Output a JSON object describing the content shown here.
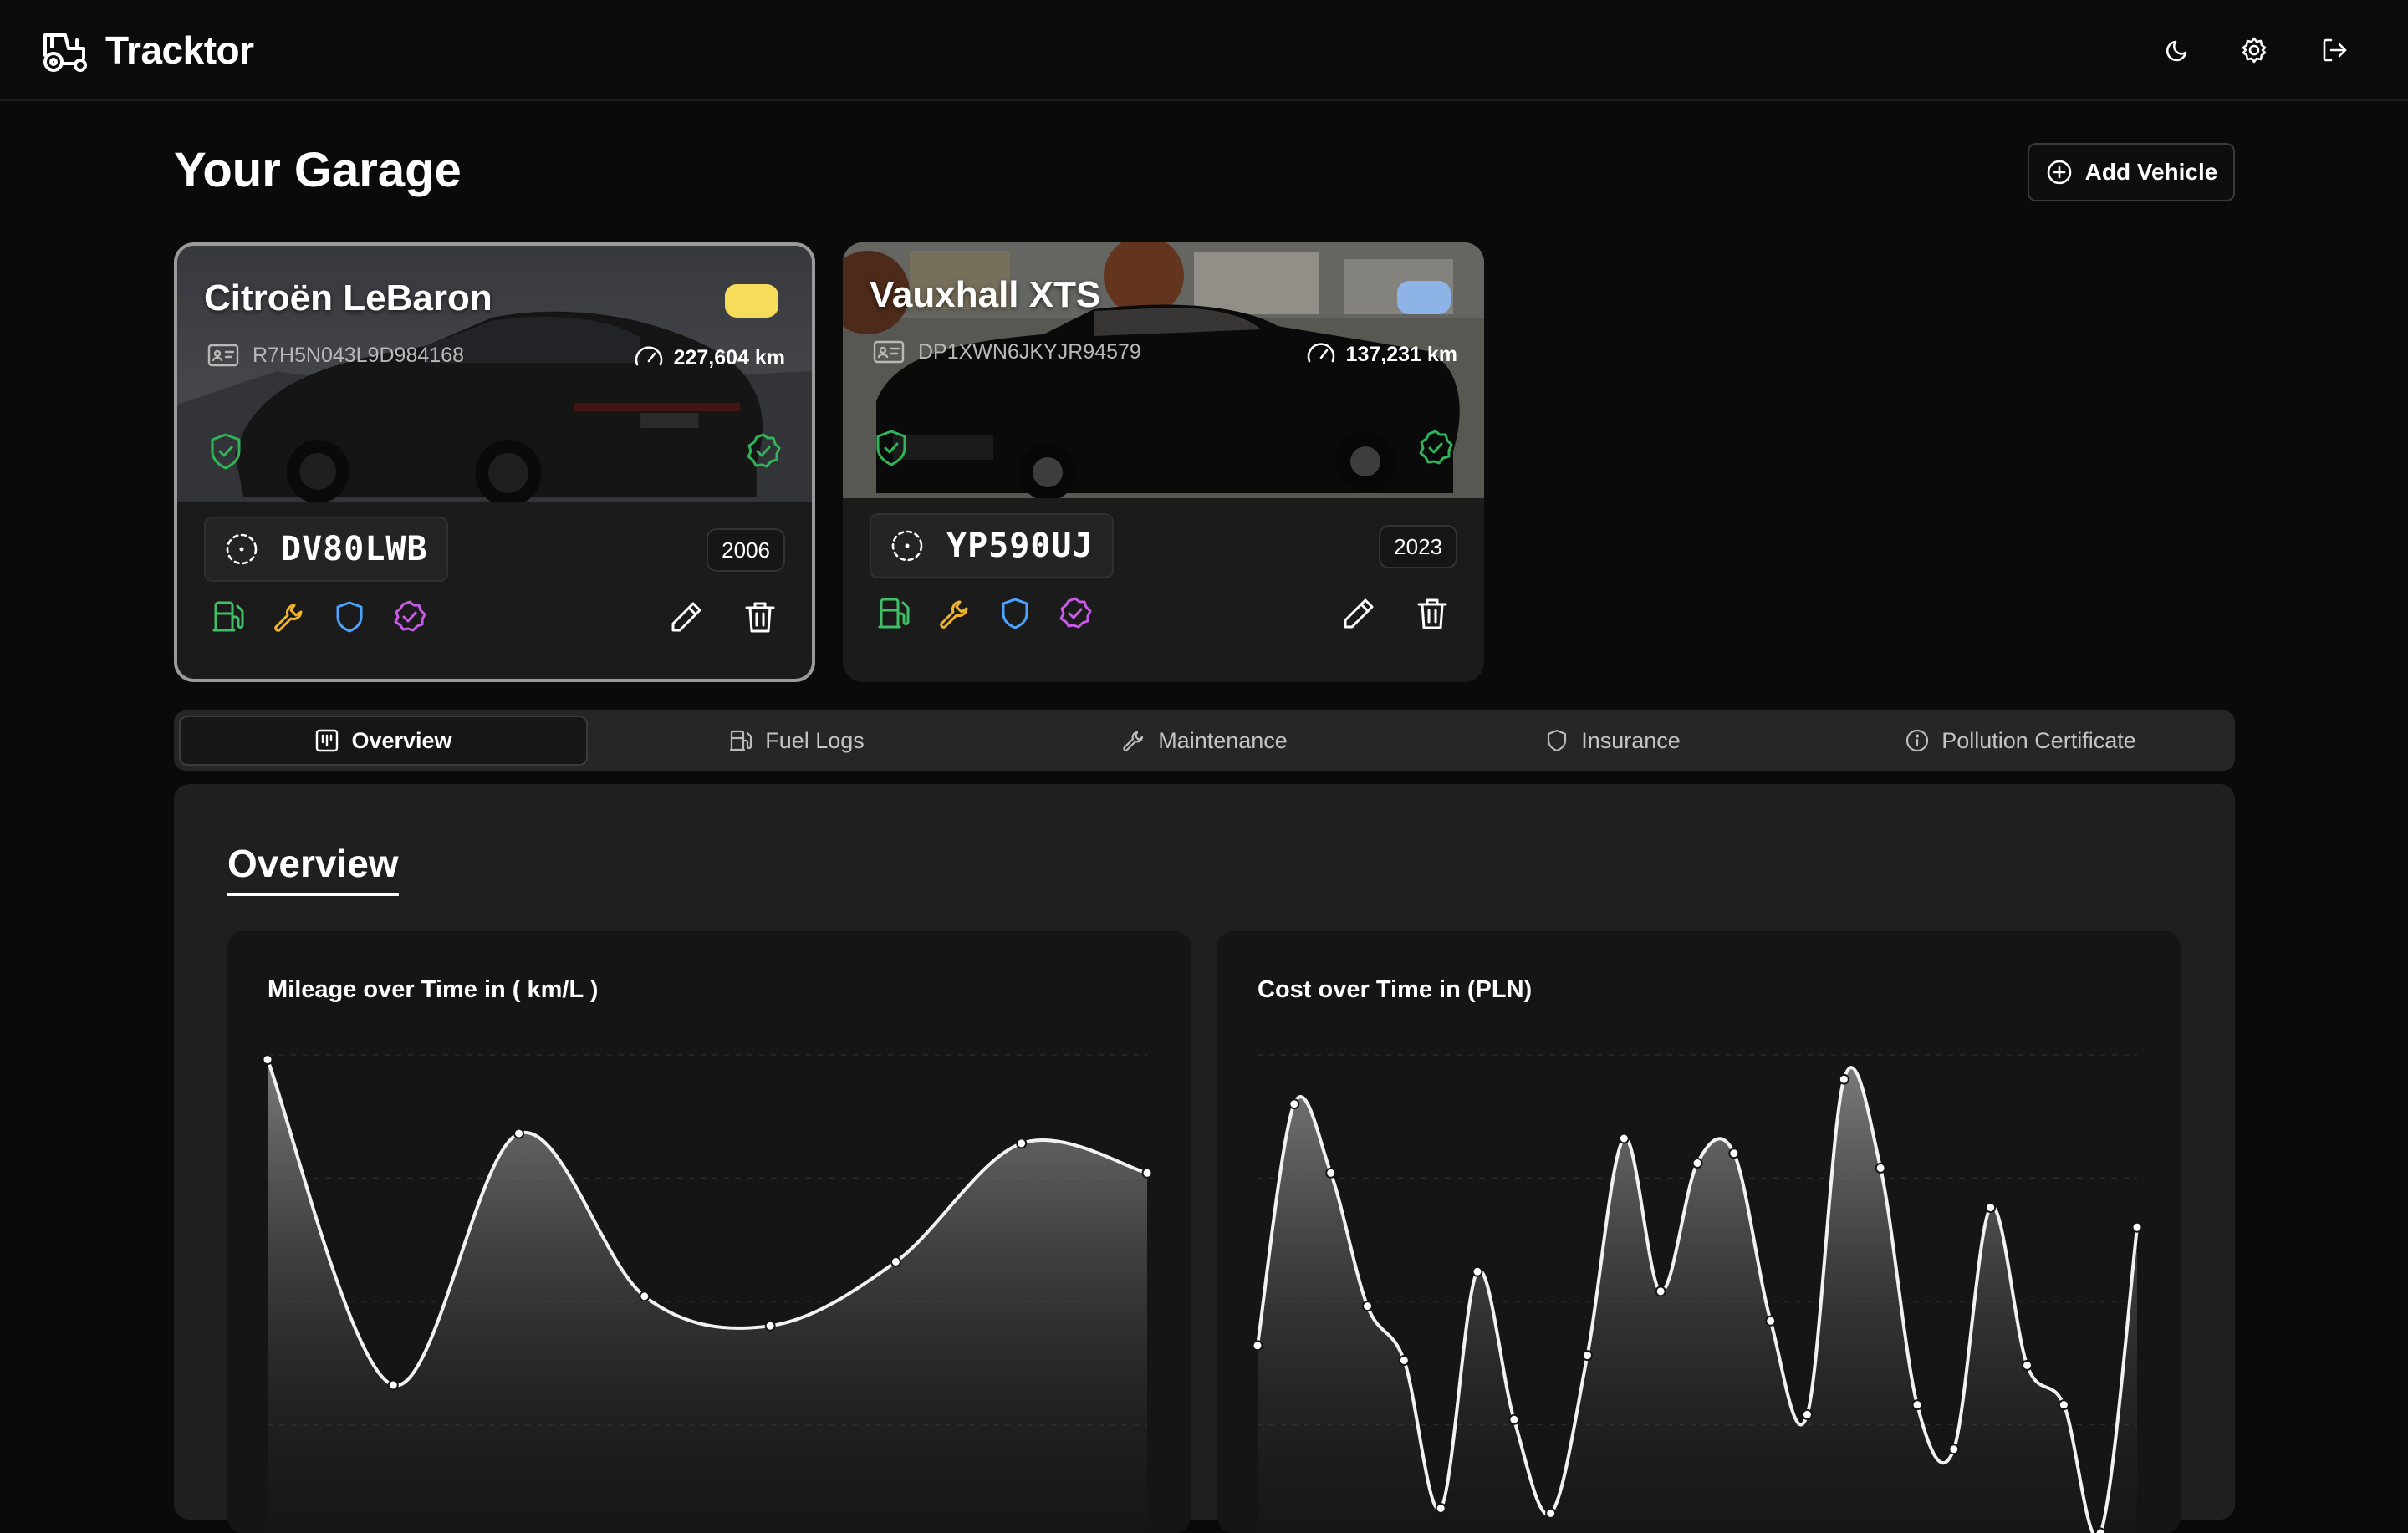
{
  "app": {
    "name": "Tracktor"
  },
  "header": {
    "theme_icon": "moon-icon",
    "settings_icon": "gear-icon",
    "logout_icon": "logout-icon"
  },
  "page": {
    "title": "Your Garage",
    "add_vehicle_label": "Add Vehicle"
  },
  "vehicles": [
    {
      "name": "Citroën LeBaron",
      "vin": "R7H5N043L9D984168",
      "odometer": "227,604 km",
      "plate": "DV80LWB",
      "year": "2006",
      "color": "#f5dc5a",
      "selected": true
    },
    {
      "name": "Vauxhall XTS",
      "vin": "DP1XWN6JKYJR94579",
      "odometer": "137,231 km",
      "plate": "YP590UJ",
      "year": "2023",
      "color": "#8eb3e6",
      "selected": false
    }
  ],
  "tabs": [
    {
      "label": "Overview",
      "icon": "overview-icon",
      "active": true
    },
    {
      "label": "Fuel Logs",
      "icon": "fuel-icon",
      "active": false
    },
    {
      "label": "Maintenance",
      "icon": "wrench-icon",
      "active": false
    },
    {
      "label": "Insurance",
      "icon": "shield-icon",
      "active": false
    },
    {
      "label": "Pollution Certificate",
      "icon": "info-icon",
      "active": false
    }
  ],
  "overview": {
    "title": "Overview"
  },
  "chart_data": [
    {
      "type": "area",
      "title": "Mileage over Time in ( km/L )",
      "xlabel": "",
      "ylabel": "",
      "grid": true,
      "ylim": [
        0,
        100
      ],
      "x": [
        1,
        2,
        3,
        4,
        5,
        6,
        7,
        8
      ],
      "values": [
        96,
        30,
        81,
        48,
        42,
        55,
        79,
        73
      ]
    },
    {
      "type": "area",
      "title": "Cost over Time in (PLN)",
      "xlabel": "",
      "ylabel": "",
      "grid": true,
      "ylim": [
        0,
        100
      ],
      "x": [
        1,
        2,
        3,
        4,
        5,
        6,
        7,
        8,
        9,
        10,
        11,
        12,
        13,
        14,
        15,
        16,
        17,
        18,
        19,
        20,
        21,
        22,
        23,
        24,
        25
      ],
      "values": [
        38,
        87,
        73,
        46,
        35,
        5,
        53,
        23,
        4,
        36,
        80,
        49,
        75,
        77,
        43,
        24,
        92,
        74,
        26,
        17,
        66,
        34,
        26,
        0,
        62
      ]
    }
  ]
}
